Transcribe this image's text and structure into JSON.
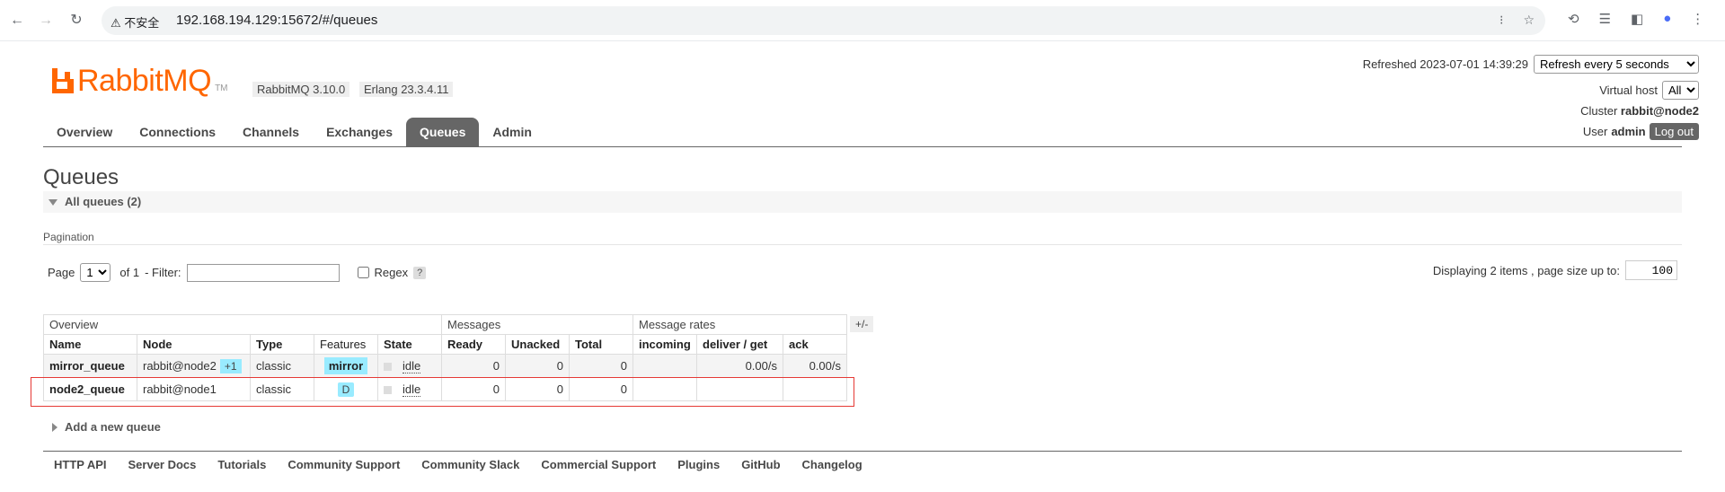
{
  "browser": {
    "security_label": "不安全",
    "url": "192.168.194.129:15672/#/queues"
  },
  "header": {
    "logo_text": "RabbitMQ",
    "logo_tm": "TM",
    "version": "RabbitMQ 3.10.0",
    "erlang": "Erlang 23.3.4.11",
    "refreshed_label": "Refreshed 2023-07-01 14:39:29",
    "refresh_option": "Refresh every 5 seconds",
    "vhost_label": "Virtual host",
    "vhost_option": "All",
    "cluster_label": "Cluster",
    "cluster_value": "rabbit@node2",
    "user_label": "User",
    "user_value": "admin",
    "logout_label": "Log out"
  },
  "tabs": [
    "Overview",
    "Connections",
    "Channels",
    "Exchanges",
    "Queues",
    "Admin"
  ],
  "active_tab": "Queues",
  "page_title": "Queues",
  "section_label": "All queues (2)",
  "pagination": {
    "label": "Pagination",
    "page_label": "Page",
    "page_value": "1",
    "of_label": "of 1",
    "filter_label": "- Filter:",
    "regex_label": "Regex",
    "help": "?",
    "display_label": "Displaying 2 items , page size up to:",
    "page_size": "100"
  },
  "table": {
    "groups": [
      "Overview",
      "Messages",
      "Message rates"
    ],
    "plus_minus": "+/-",
    "columns": [
      "Name",
      "Node",
      "Type",
      "Features",
      "State",
      "Ready",
      "Unacked",
      "Total",
      "incoming",
      "deliver / get",
      "ack"
    ],
    "rows": [
      {
        "name": "mirror_queue",
        "node": "rabbit@node2",
        "node_extra": "+1",
        "type": "classic",
        "feature": "mirror",
        "state": "idle",
        "ready": "0",
        "unacked": "0",
        "total": "0",
        "incoming": "",
        "deliver": "0.00/s",
        "ack": "0.00/s"
      },
      {
        "name": "node2_queue",
        "node": "rabbit@node1",
        "node_extra": "",
        "type": "classic",
        "feature": "D",
        "state": "idle",
        "ready": "0",
        "unacked": "0",
        "total": "0",
        "incoming": "",
        "deliver": "",
        "ack": ""
      }
    ]
  },
  "add_queue_label": "Add a new queue",
  "footer": [
    "HTTP API",
    "Server Docs",
    "Tutorials",
    "Community Support",
    "Community Slack",
    "Commercial Support",
    "Plugins",
    "GitHub",
    "Changelog"
  ],
  "colors": {
    "brand": "#ff6600",
    "feature_badge": "#99ebff",
    "highlight": "#e53935"
  }
}
